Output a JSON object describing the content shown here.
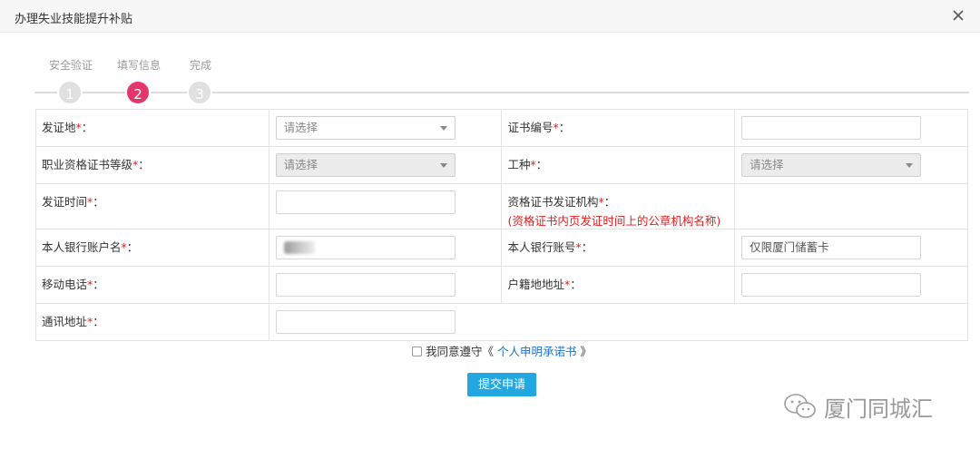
{
  "dialog": {
    "title": "办理失业技能提升补贴"
  },
  "steps": [
    {
      "label": "安全验证",
      "number": "1",
      "active": false
    },
    {
      "label": "填写信息",
      "number": "2",
      "active": true
    },
    {
      "label": "完成",
      "number": "3",
      "active": false
    }
  ],
  "form": {
    "cert_place": {
      "label": "发证地",
      "placeholder": "请选择"
    },
    "cert_number": {
      "label": "证书编号",
      "value": ""
    },
    "cert_level": {
      "label": "职业资格证书等级",
      "placeholder": "请选择"
    },
    "job_type": {
      "label": "工种",
      "placeholder": "请选择"
    },
    "cert_date": {
      "label": "发证时间",
      "value": ""
    },
    "cert_authority": {
      "label": "资格证书发证机构",
      "note": "(资格证书内页发证时间上的公章机构名称)"
    },
    "bank_account_name": {
      "label": "本人银行账户名"
    },
    "bank_account_number": {
      "label": "本人银行账号",
      "value": "仅限厦门储蓄卡"
    },
    "mobile": {
      "label": "移动电话",
      "value": ""
    },
    "household_address": {
      "label": "户籍地地址",
      "value": ""
    },
    "mail_address": {
      "label": "通讯地址",
      "value": ""
    },
    "required_mark": "*",
    "colon": "："
  },
  "agreement": {
    "prefix": "我同意遵守《",
    "link": " 个人申明承诺书 ",
    "suffix": "》"
  },
  "submit_label": "提交申请",
  "watermark": "厦门同城汇",
  "colors": {
    "accent": "#e5366a",
    "button": "#22a7e0",
    "required": "#e02020",
    "link": "#1a73c9"
  }
}
